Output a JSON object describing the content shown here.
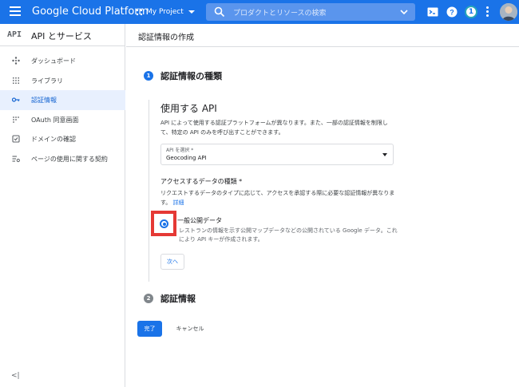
{
  "topbar": {
    "brand": "Google Cloud Platform",
    "project": "My Project",
    "search_placeholder": "プロダクトとリソースの検索",
    "notification_count": "1"
  },
  "sidebar": {
    "logo": "API",
    "title": "API とサービス",
    "items": [
      {
        "label": "ダッシュボード",
        "icon": "dashboard-icon"
      },
      {
        "label": "ライブラリ",
        "icon": "library-icon"
      },
      {
        "label": "認証情報",
        "icon": "key-icon"
      },
      {
        "label": "OAuth 同意画面",
        "icon": "oauth-icon"
      },
      {
        "label": "ドメインの確認",
        "icon": "checkbox-icon"
      },
      {
        "label": "ページの使用に関する契約",
        "icon": "settings-list-icon"
      }
    ],
    "collapse_label": "<|"
  },
  "page": {
    "title": "認証情報の作成"
  },
  "step1": {
    "number": "1",
    "title": "認証情報の種類",
    "section_title": "使用する API",
    "description": "API によって使用する認証プラットフォームが異なります。また、一部の認証情報を制限して、特定の API のみを呼び出すことができます。",
    "select_label": "API を選択 *",
    "select_value": "Geocoding API",
    "question_label": "アクセスするデータの種類 *",
    "question_desc": "リクエストするデータのタイプに応じて、アクセスを承認する際に必要な認証情報が異なります。",
    "details_link": "詳細",
    "option_label": "一般公開データ",
    "option_desc": "レストランの情報を示す公開マップデータなどの公開されている Google データ。これにより API キーが作成されます。",
    "next_button": "次へ"
  },
  "step2": {
    "number": "2",
    "title": "認証情報"
  },
  "actions": {
    "done": "完了",
    "cancel": "キャンセル"
  },
  "colors": {
    "accent": "#1a73e8",
    "highlight": "#e53935"
  }
}
